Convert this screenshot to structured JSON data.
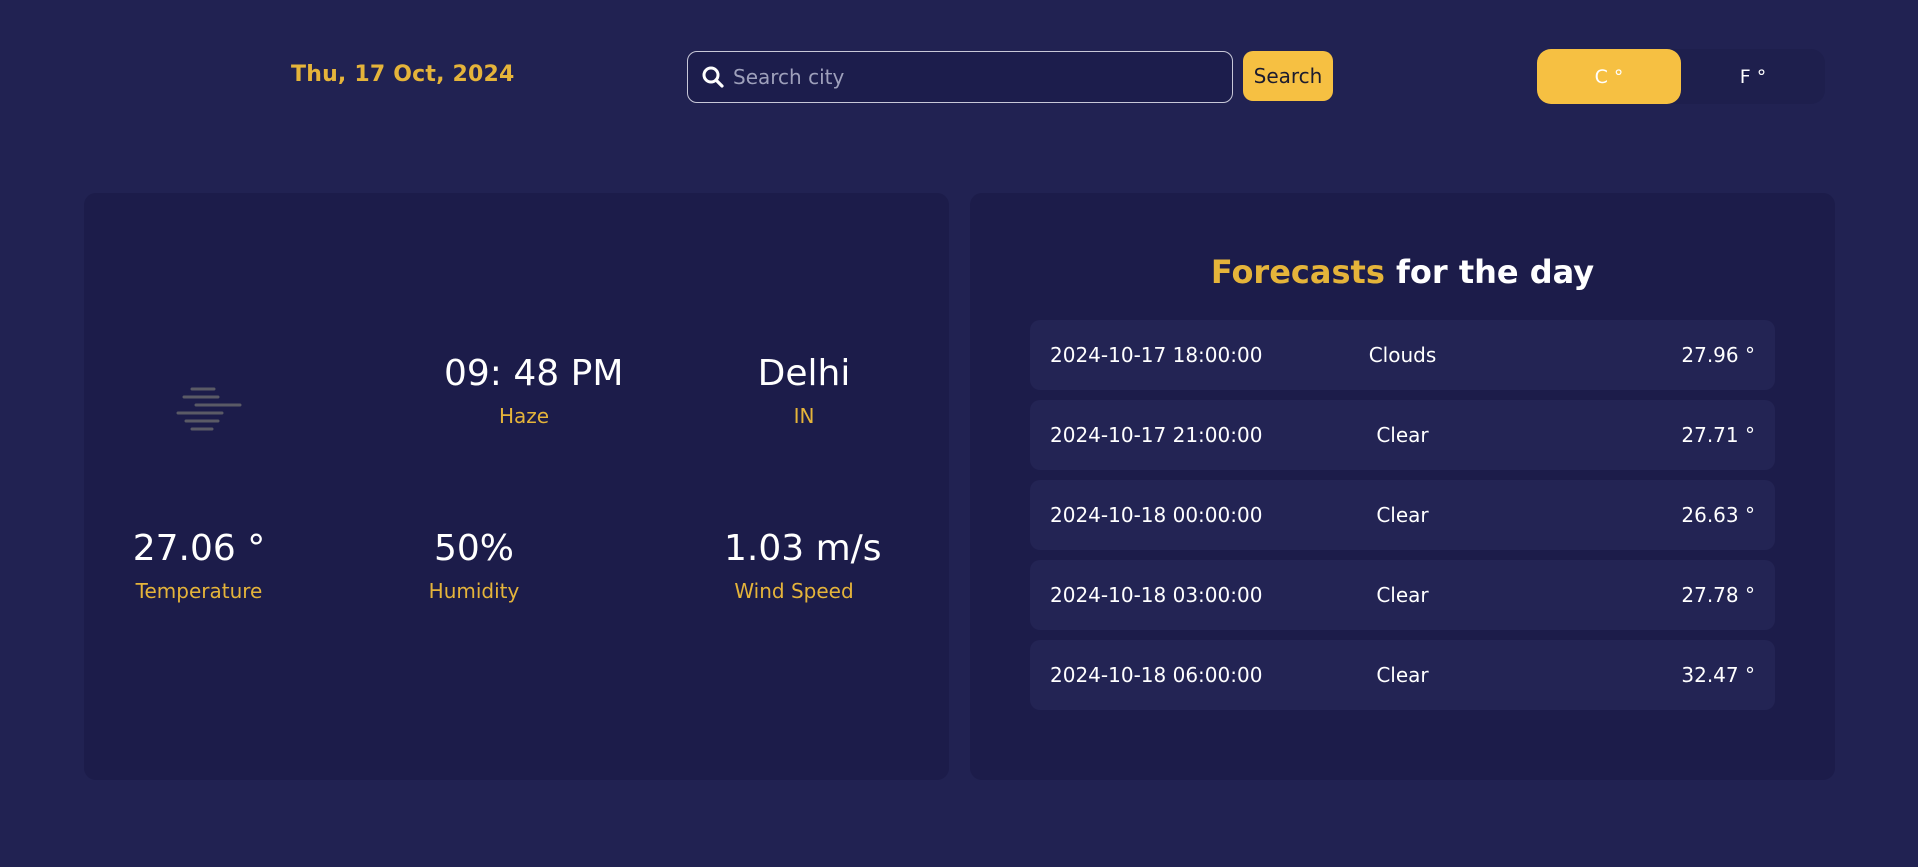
{
  "header": {
    "date": "Thu, 17 Oct, 2024",
    "search_placeholder": "Search city",
    "search_value": "",
    "search_button": "Search",
    "unit_celsius": "C °",
    "unit_fahrenheit": "F °",
    "selected_unit": "C °"
  },
  "current": {
    "icon": "haze-icon",
    "time": "09: 48 PM",
    "condition": "Haze",
    "city": "Delhi",
    "country": "IN",
    "temperature": "27.06 °",
    "temperature_label": "Temperature",
    "humidity": "50%",
    "humidity_label": "Humidity",
    "wind_speed": "1.03 m/s",
    "wind_speed_label": "Wind Speed"
  },
  "forecast": {
    "title_accent": "Forecasts",
    "title_rest": " for the day",
    "items": [
      {
        "datetime": "2024-10-17 18:00:00",
        "condition": "Clouds",
        "temp": "27.96 °"
      },
      {
        "datetime": "2024-10-17 21:00:00",
        "condition": "Clear",
        "temp": "27.71 °"
      },
      {
        "datetime": "2024-10-18 00:00:00",
        "condition": "Clear",
        "temp": "26.63 °"
      },
      {
        "datetime": "2024-10-18 03:00:00",
        "condition": "Clear",
        "temp": "27.78 °"
      },
      {
        "datetime": "2024-10-18 06:00:00",
        "condition": "Clear",
        "temp": "32.47 °"
      }
    ]
  },
  "colors": {
    "background": "#212252",
    "card": "#1c1c4a",
    "row": "#232454",
    "accent": "#e5b43a",
    "button": "#f6c042"
  }
}
